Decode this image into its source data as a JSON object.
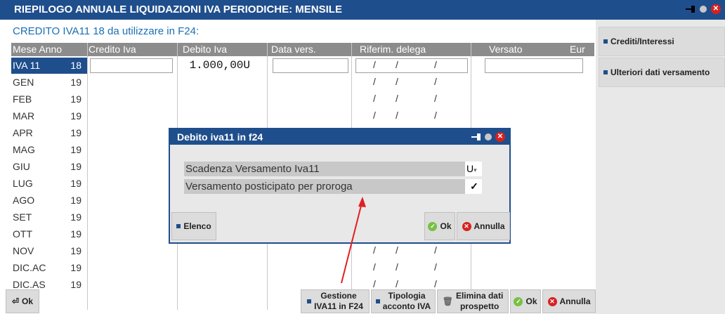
{
  "window": {
    "title": "RIEPILOGO ANNUALE LIQUIDAZIONI IVA PERIODICHE: MENSILE"
  },
  "credito_label": "CREDITO IVA11 18 da utilizzare in F24:",
  "table": {
    "headers": {
      "mese_anno": "Mese Anno",
      "credito": "Credito Iva",
      "debito": "Debito  Iva",
      "data_vers": "Data vers.",
      "riferim": "Riferim. delega",
      "versato": "Versato",
      "eur": "Eur"
    },
    "rows": [
      {
        "mese": "IVA 11",
        "anno": "18",
        "debito": "1.000,00U"
      },
      {
        "mese": "GEN",
        "anno": "19"
      },
      {
        "mese": "FEB",
        "anno": "19"
      },
      {
        "mese": "MAR",
        "anno": "19"
      },
      {
        "mese": "APR",
        "anno": "19"
      },
      {
        "mese": "MAG",
        "anno": "19"
      },
      {
        "mese": "GIU",
        "anno": "19"
      },
      {
        "mese": "LUG",
        "anno": "19"
      },
      {
        "mese": "AGO",
        "anno": "19"
      },
      {
        "mese": "SET",
        "anno": "19"
      },
      {
        "mese": "OTT",
        "anno": "19"
      },
      {
        "mese": "NOV",
        "anno": "19"
      },
      {
        "mese": "DIC.AC",
        "anno": "19"
      },
      {
        "mese": "DIC.AS",
        "anno": "19"
      }
    ],
    "slash": "/"
  },
  "side": {
    "crediti": "Crediti/Interessi",
    "ulteriori": "Ulteriori dati versamento"
  },
  "bottom": {
    "ok_left": "Ok",
    "gestione_1": "Gestione",
    "gestione_2": "IVA11 in F24",
    "tipologia_1": "Tipologia",
    "tipologia_2": "acconto IVA",
    "elimina_1": "Elimina dati",
    "elimina_2": "prospetto",
    "ok": "Ok",
    "annulla": "Annulla"
  },
  "dialog": {
    "title": "Debito iva11 in f24",
    "scadenza_label": "Scadenza Versamento Iva11",
    "scadenza_value": "U",
    "posticipato_label": "Versamento posticipato per proroga",
    "posticipato_value": "✓",
    "elenco": "Elenco",
    "ok": "Ok",
    "annulla": "Annulla"
  },
  "colors": {
    "accent": "#1f4e8c",
    "credito_text": "#1a6fb4",
    "arrow": "#e02020"
  }
}
